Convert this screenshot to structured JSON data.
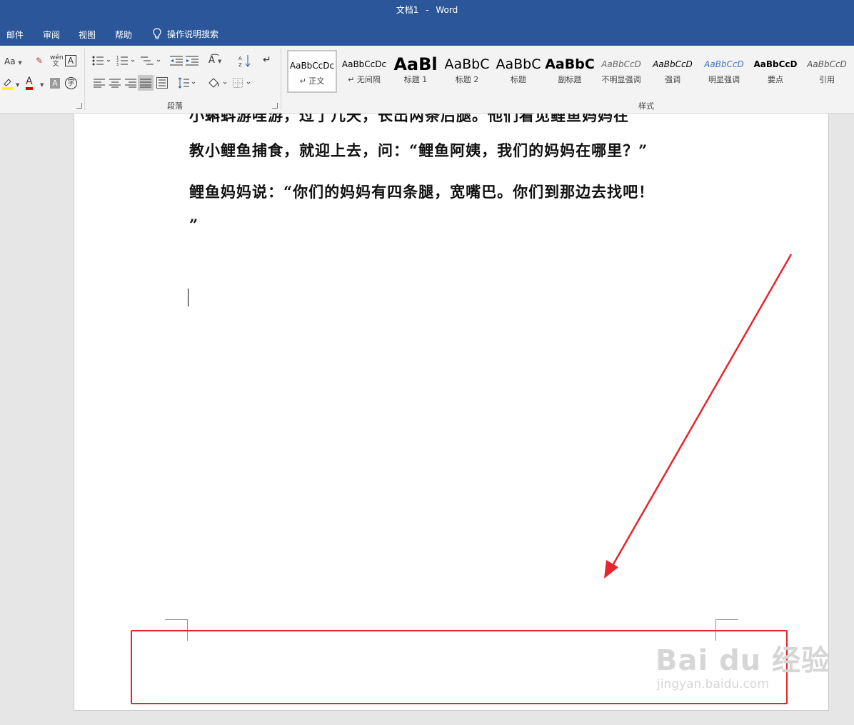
{
  "titlebar": {
    "doc_name": "文档1",
    "separator": "-",
    "app_name": "Word"
  },
  "tabs": [
    "邮件",
    "审阅",
    "视图",
    "帮助"
  ],
  "tell_me": {
    "label": "操作说明搜索"
  },
  "ribbon": {
    "font_group": {
      "aa_label": "Aa",
      "phonetic_label": "wén",
      "char_border_label": "A",
      "font_color_label": "A",
      "char_shading_label": "A",
      "enclose_label": "字"
    },
    "paragraph_group": {
      "label": "段落"
    },
    "styles_group": {
      "label": "样式",
      "items": [
        {
          "sample": "AaBbCcDc",
          "name": "正文"
        },
        {
          "sample": "AaBbCcDc",
          "name": "无间隔"
        },
        {
          "sample": "AaBl",
          "name": "标题 1"
        },
        {
          "sample": "AaBbC",
          "name": "标题 2"
        },
        {
          "sample": "AaBbC",
          "name": "标题"
        },
        {
          "sample": "AaBbC",
          "name": "副标题"
        },
        {
          "sample": "AaBbCcD",
          "name": "不明显强调"
        },
        {
          "sample": "AaBbCcD",
          "name": "强调"
        },
        {
          "sample": "AaBbCcD",
          "name": "明显强调"
        },
        {
          "sample": "AaBbCcD",
          "name": "要点"
        },
        {
          "sample": "AaBbCcD",
          "name": "引用"
        }
      ]
    }
  },
  "document": {
    "lines": [
      "小蝌蚪游哇游，过了几天，长出两条后腿。他们看见鲤鱼妈妈在",
      "教小鲤鱼捕食，就迎上去，问：“鲤鱼阿姨，我们的妈妈在哪里？”",
      "鲤鱼妈妈说：“你们的妈妈有四条腿，宽嘴巴。你们到那边去找吧！",
      "”"
    ]
  },
  "watermark": {
    "main": "Bai du 经验",
    "sub": "jingyan.baidu.com"
  },
  "colors": {
    "title_blue": "#2b579a",
    "annotation_red": "#e8242c"
  }
}
